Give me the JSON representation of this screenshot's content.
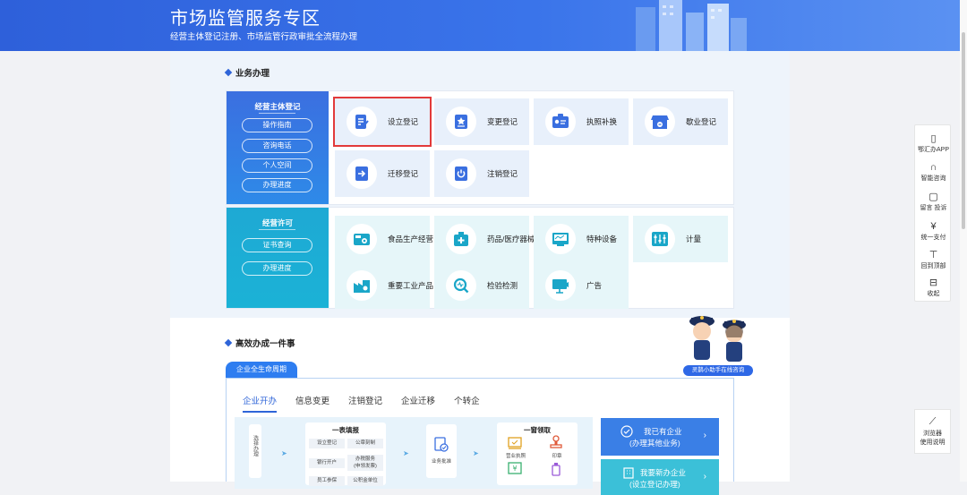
{
  "banner": {
    "title": "市场监管服务专区",
    "subtitle": "经营主体登记注册、市场监管行政审批全流程办理"
  },
  "section1": {
    "title": "业务办理"
  },
  "registration": {
    "header": "经营主体登记",
    "links": [
      "操作指南",
      "咨询电话",
      "个人空间",
      "办理进度"
    ],
    "tiles": [
      {
        "label": "设立登记",
        "icon": "edit-doc-icon",
        "selected": true
      },
      {
        "label": "变更登记",
        "icon": "star-doc-icon"
      },
      {
        "label": "执照补换",
        "icon": "id-card-icon"
      },
      {
        "label": "歇业登记",
        "icon": "shop-icon"
      },
      {
        "label": "迁移登记",
        "icon": "move-arrow-icon"
      },
      {
        "label": "注销登记",
        "icon": "power-icon"
      }
    ]
  },
  "license": {
    "header": "经营许可",
    "links": [
      "证书查询",
      "办理进度"
    ],
    "tiles": [
      {
        "label": "食品生产经营",
        "icon": "food-icon"
      },
      {
        "label": "药品/医疗器械",
        "icon": "medicine-icon"
      },
      {
        "label": "特种设备",
        "icon": "equipment-icon"
      },
      {
        "label": "计量",
        "icon": "meter-icon"
      },
      {
        "label": "重要工业产品",
        "icon": "industry-icon"
      },
      {
        "label": "检验检测",
        "icon": "inspect-icon"
      },
      {
        "label": "广告",
        "icon": "ad-icon"
      }
    ]
  },
  "section2": {
    "title": "高效办成一件事"
  },
  "lifecycle": {
    "tab": "企业全生命周期",
    "tabs": [
      "企业开办",
      "信息变更",
      "注销登记",
      "企业迁移",
      "个转企"
    ],
    "active_tab": 0,
    "flow": {
      "side_label": "选择办理",
      "form_title": "一表填报",
      "form_items": [
        "设立登记",
        "公章刻制",
        "银行开户",
        "办税服务\n(申领发票)",
        "员工参保",
        "公积金单位"
      ],
      "approve_label": "业务批准",
      "collect_title": "一窗领取",
      "collect_items": [
        "营业执照",
        "印章"
      ]
    },
    "cards": [
      {
        "line1": "我已有企业",
        "line2": "(办理其他业务)"
      },
      {
        "line1": "我要新办企业",
        "line2": "(设立登记办理)"
      }
    ]
  },
  "assistant": {
    "label": "灵鹊小助手在线咨询"
  },
  "rightbar": {
    "items": [
      {
        "label": "鄂汇办APP",
        "icon": "phone-icon"
      },
      {
        "label": "智能咨询",
        "icon": "headset-icon"
      },
      {
        "label": "留言 投诉",
        "icon": "message-icon"
      },
      {
        "label": "统一支付",
        "icon": "yen-icon"
      },
      {
        "label": "回到顶部",
        "icon": "top-icon"
      },
      {
        "label": "收起",
        "icon": "collapse-icon"
      }
    ],
    "browser_label_1": "浏览器",
    "browser_label_2": "使用说明"
  },
  "colors": {
    "primary": "#2e64d8",
    "cyan": "#1bb2d6",
    "selected_outline": "#e23a3a"
  }
}
